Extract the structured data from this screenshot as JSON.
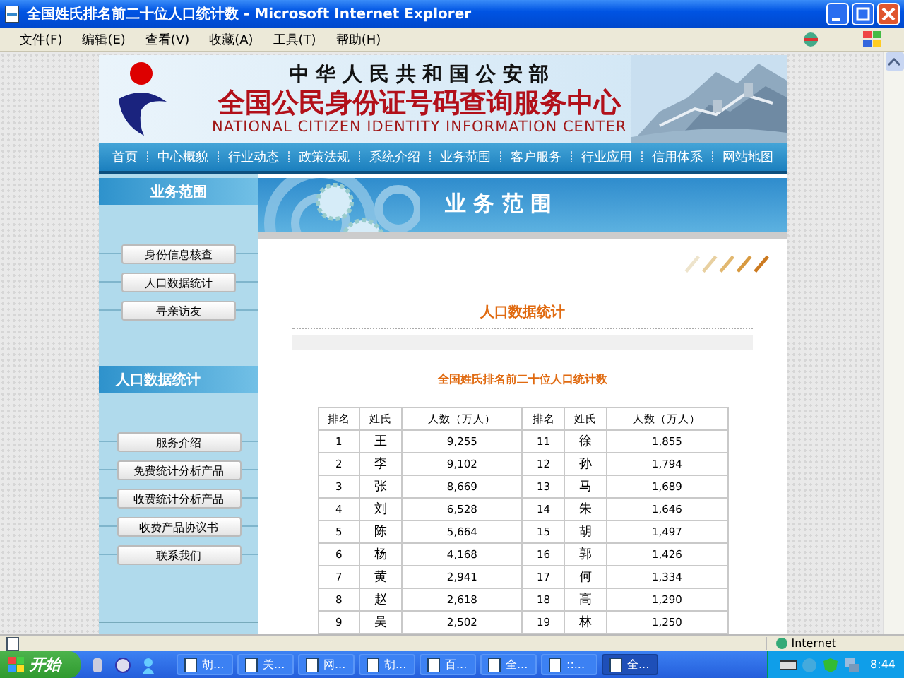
{
  "window": {
    "title": "全国姓氏排名前二十位人口统计数 - Microsoft Internet Explorer"
  },
  "menu": [
    "文件(F)",
    "编辑(E)",
    "查看(V)",
    "收藏(A)",
    "工具(T)",
    "帮助(H)"
  ],
  "header": {
    "ministry": "中 华 人 民 共 和 国 公 安 部",
    "center_cn": "全国公民身份证号码查询服务中心",
    "center_en": "NATIONAL CITIZEN IDENTITY INFORMATION CENTER"
  },
  "nav": [
    "首页",
    "中心概貌",
    "行业动态",
    "政策法规",
    "系统介绍",
    "业务范围",
    "客户服务",
    "行业应用",
    "信用体系",
    "网站地图"
  ],
  "sidebar": [
    {
      "heading": "业务范围",
      "items": [
        "身份信息核查",
        "人口数据统计",
        "寻亲访友"
      ]
    },
    {
      "heading": "人口数据统计",
      "items": [
        "服务介绍",
        "免费统计分析产品",
        "收费统计分析产品",
        "收费产品协议书",
        "联系我们"
      ]
    }
  ],
  "section_banner": "业 务 范 围",
  "page_heading": "人口数据统计",
  "table": {
    "caption": "全国姓氏排名前二十位人口统计数",
    "columns": [
      "排名",
      "姓氏",
      "人数（万人）",
      "排名",
      "姓氏",
      "人数（万人）"
    ],
    "rows": [
      [
        "1",
        "王",
        "9,255",
        "11",
        "徐",
        "1,855"
      ],
      [
        "2",
        "李",
        "9,102",
        "12",
        "孙",
        "1,794"
      ],
      [
        "3",
        "张",
        "8,669",
        "13",
        "马",
        "1,689"
      ],
      [
        "4",
        "刘",
        "6,528",
        "14",
        "朱",
        "1,646"
      ],
      [
        "5",
        "陈",
        "5,664",
        "15",
        "胡",
        "1,497"
      ],
      [
        "6",
        "杨",
        "4,168",
        "16",
        "郭",
        "1,426"
      ],
      [
        "7",
        "黄",
        "2,941",
        "17",
        "何",
        "1,334"
      ],
      [
        "8",
        "赵",
        "2,618",
        "18",
        "高",
        "1,290"
      ],
      [
        "9",
        "吴",
        "2,502",
        "19",
        "林",
        "1,250"
      ]
    ]
  },
  "status_bar": {
    "zone": "Internet"
  },
  "taskbar": {
    "start": "开始",
    "tasks": [
      {
        "label": "胡...",
        "selected": false
      },
      {
        "label": "关...",
        "selected": false
      },
      {
        "label": "网...",
        "selected": false
      },
      {
        "label": "胡...",
        "selected": false
      },
      {
        "label": "百...",
        "selected": false
      },
      {
        "label": "全...",
        "selected": false
      },
      {
        "label": "::...",
        "selected": false
      },
      {
        "label": "全...",
        "selected": true
      }
    ],
    "clock": "8:44"
  }
}
